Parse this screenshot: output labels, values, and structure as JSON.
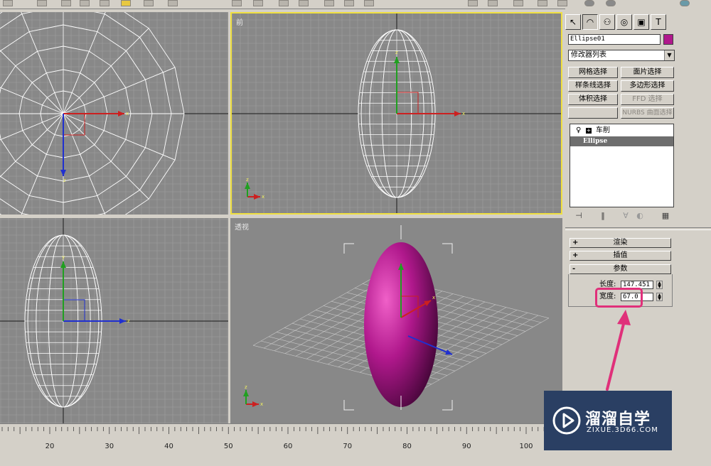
{
  "viewports": {
    "top_left": {
      "label": ""
    },
    "front": {
      "label": "前"
    },
    "bottom_left": {
      "label": ""
    },
    "perspective": {
      "label": "透视"
    }
  },
  "axis_labels": {
    "x": "x",
    "y": "y",
    "z": "z"
  },
  "command_panel": {
    "tabs": [
      "create-icon",
      "modify-icon",
      "hierarchy-icon",
      "motion-icon",
      "display-icon",
      "utilities-icon"
    ],
    "object_name": "Ellipse01",
    "object_color": "#b0188c",
    "modifier_list": "修改器列表",
    "modifier_buttons": {
      "mesh_select": "网格选择",
      "patch_select": "面片选择",
      "spline_select": "样条线选择",
      "poly_select": "多边形选择",
      "volume_select": "体积选择",
      "ffd_select": "FFD 选择",
      "nurbs_select": "NURBS 曲面选择"
    },
    "stack": {
      "modifier": "车削",
      "base": "Ellipse"
    },
    "rollouts": {
      "render": "渲染",
      "interpolation": "插值",
      "parameters": "参数"
    },
    "params": {
      "length_label": "长度:",
      "length_value": "147.451",
      "width_label": "宽度:",
      "width_value": "67.0"
    }
  },
  "ruler": {
    "ticks": [
      "20",
      "30",
      "40",
      "50",
      "60",
      "70",
      "80",
      "90",
      "100"
    ]
  },
  "watermark": {
    "title": "溜溜自学",
    "subtitle": "ZIXUE.3D66.COM"
  }
}
